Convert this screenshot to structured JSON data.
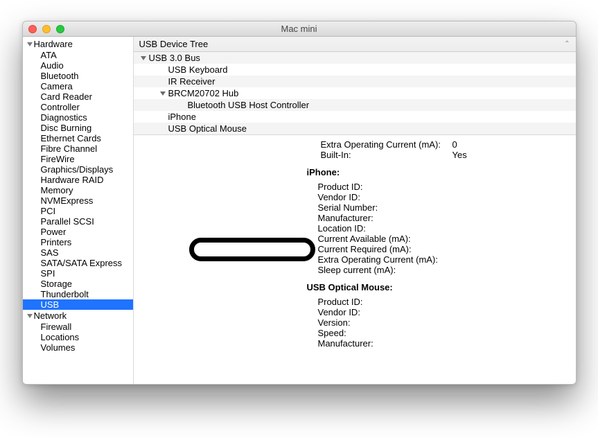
{
  "window": {
    "title": "Mac mini"
  },
  "sidebar": {
    "categories": [
      {
        "label": "Hardware",
        "items": [
          "ATA",
          "Audio",
          "Bluetooth",
          "Camera",
          "Card Reader",
          "Controller",
          "Diagnostics",
          "Disc Burning",
          "Ethernet Cards",
          "Fibre Channel",
          "FireWire",
          "Graphics/Displays",
          "Hardware RAID",
          "Memory",
          "NVMExpress",
          "PCI",
          "Parallel SCSI",
          "Power",
          "Printers",
          "SAS",
          "SATA/SATA Express",
          "SPI",
          "Storage",
          "Thunderbolt",
          "USB"
        ]
      },
      {
        "label": "Network",
        "items": [
          "Firewall",
          "Locations",
          "Volumes"
        ]
      }
    ],
    "selected": "USB"
  },
  "header": {
    "title": "USB Device Tree"
  },
  "tree": {
    "rows": [
      {
        "indent": 0,
        "label": "USB 3.0 Bus",
        "expandable": true
      },
      {
        "indent": 1,
        "label": "USB Keyboard"
      },
      {
        "indent": 1,
        "label": "IR Receiver"
      },
      {
        "indent": 1,
        "label": "BRCM20702 Hub",
        "expandable": true
      },
      {
        "indent": 2,
        "label": "Bluetooth USB Host Controller"
      },
      {
        "indent": 1,
        "label": "iPhone"
      },
      {
        "indent": 1,
        "label": "USB Optical Mouse"
      }
    ]
  },
  "details": {
    "top": [
      {
        "k": "Extra Operating Current (mA):",
        "v": "0"
      },
      {
        "k": "Built-In:",
        "v": "Yes"
      }
    ],
    "sections": [
      {
        "title": "iPhone:",
        "rows": [
          {
            "k": "Product ID:",
            "v": ""
          },
          {
            "k": "Vendor ID:",
            "v": ""
          },
          {
            "k": "Serial Number:",
            "v": "",
            "highlight": true
          },
          {
            "k": "Manufacturer:",
            "v": ""
          },
          {
            "k": "Location ID:",
            "v": ""
          },
          {
            "k": "Current Available (mA):",
            "v": ""
          },
          {
            "k": "Current Required (mA):",
            "v": ""
          },
          {
            "k": "Extra Operating Current (mA):",
            "v": ""
          },
          {
            "k": "Sleep current (mA):",
            "v": ""
          }
        ]
      },
      {
        "title": "USB Optical Mouse:",
        "rows": [
          {
            "k": "Product ID:",
            "v": ""
          },
          {
            "k": "Vendor ID:",
            "v": ""
          },
          {
            "k": "Version:",
            "v": ""
          },
          {
            "k": "Speed:",
            "v": ""
          },
          {
            "k": "Manufacturer:",
            "v": ""
          }
        ]
      }
    ]
  }
}
